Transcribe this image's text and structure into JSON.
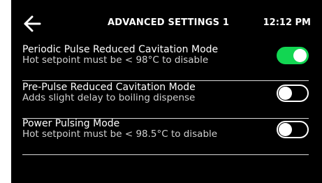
{
  "colors": {
    "background": "#000000",
    "text": "#ffffff",
    "subtext": "#d0d0d0",
    "toggle_on": "#12d652",
    "divider": "#d8d8d8"
  },
  "header": {
    "back_icon": "arrow-left-icon",
    "title": "ADVANCED SETTINGS 1",
    "time": "12:12 PM"
  },
  "settings": [
    {
      "label": "Periodic Pulse Reduced Cavitation Mode",
      "description": "Hot setpoint must be < 98°C to disable",
      "enabled": true
    },
    {
      "label": "Pre-Pulse Reduced Cavitation Mode",
      "description": "Adds slight delay to boiling dispense",
      "enabled": false
    },
    {
      "label": "Power Pulsing Mode",
      "description": "Hot setpoint must be < 98.5°C to disable",
      "enabled": false
    }
  ]
}
